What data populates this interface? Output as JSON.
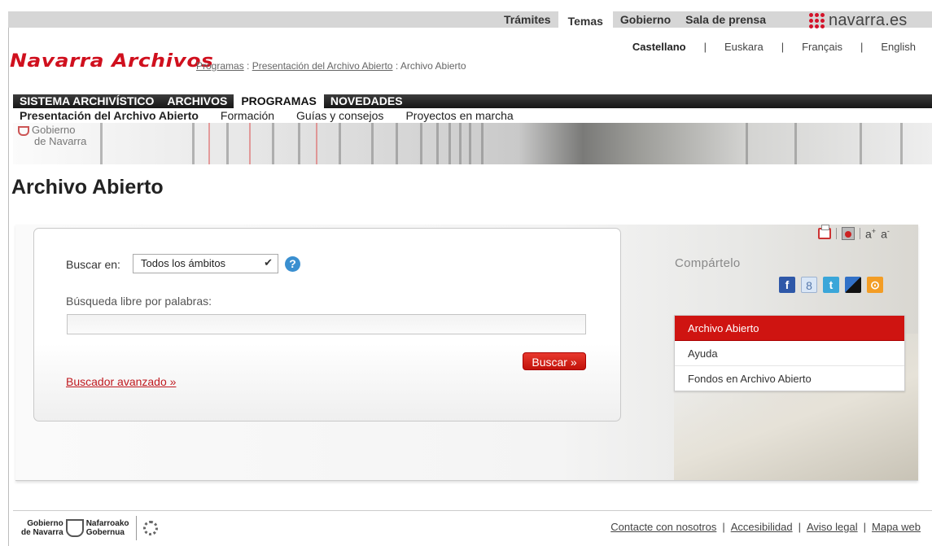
{
  "topnav": {
    "items": [
      "Trámites",
      "Temas",
      "Gobierno",
      "Sala de prensa"
    ],
    "active_index": 1,
    "brand": "navarra.es"
  },
  "languages": [
    "Castellano",
    "Euskara",
    "Français",
    "English"
  ],
  "current_language": "Castellano",
  "header": {
    "logo": "Navarra Archivos",
    "breadcrumb": [
      "Programas",
      "Presentación del Archivo Abierto",
      "Archivo Abierto"
    ]
  },
  "mainnav": [
    "SISTEMA ARCHIVÍSTICO",
    "ARCHIVOS",
    "PROGRAMAS",
    "NOVEDADES"
  ],
  "mainnav_active": "PROGRAMAS",
  "subnav": [
    "Presentación del Archivo Abierto",
    "Formación",
    "Guías y consejos",
    "Proyectos en marcha"
  ],
  "banner": {
    "logo_line1": "Gobierno",
    "logo_line2": "de Navarra"
  },
  "page_title": "Archivo Abierto",
  "search": {
    "scope_label": "Buscar en:",
    "scope_value": "Todos los ámbitos",
    "help_glyph": "?",
    "free_label": "Búsqueda libre por palabras:",
    "free_value": "",
    "button": "Buscar »",
    "advanced_link": "Buscador avanzado »"
  },
  "tools": {
    "font_up": "a",
    "font_down": "a"
  },
  "share": {
    "label": "Compártelo",
    "icons": [
      "facebook-icon",
      "google-icon",
      "twitter-icon",
      "delicious-icon",
      "rss-icon"
    ]
  },
  "sidemenu": [
    "Archivo Abierto",
    "Ayuda",
    "Fondos en Archivo Abierto"
  ],
  "footer": {
    "logo_left": [
      "Gobierno",
      "de Navarra"
    ],
    "logo_right": [
      "Nafarroako",
      "Gobernua"
    ],
    "links": [
      "Contacte con nosotros",
      "Accesibilidad",
      "Aviso legal",
      "Mapa web"
    ]
  },
  "colors": {
    "accent_red": "#d0101e",
    "nav_dark": "#1f1f1f",
    "topbar": "#d6d6d6",
    "link_red": "#c0191f"
  }
}
